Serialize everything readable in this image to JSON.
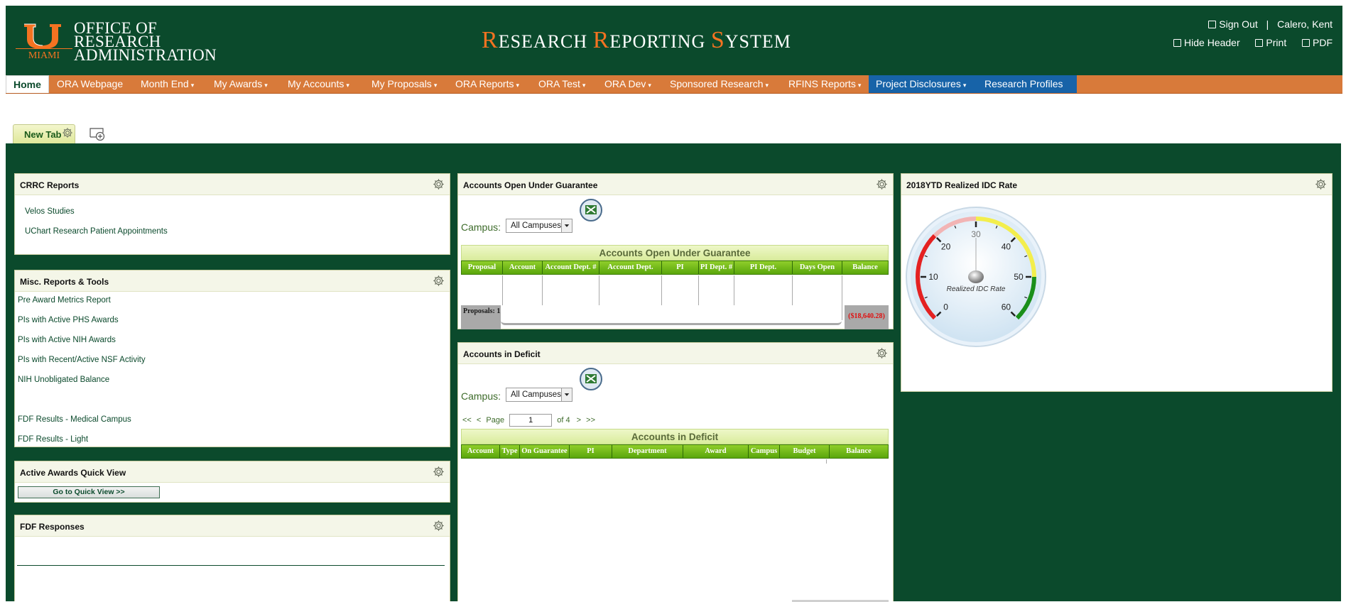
{
  "header": {
    "logo_text": "MIAMI",
    "office_title": [
      "OFFICE OF",
      "RESEARCH",
      "ADMINISTRATION"
    ],
    "system_title": [
      {
        "cap": "R",
        "rest": "ESEARCH "
      },
      {
        "cap": "R",
        "rest": "EPORTING "
      },
      {
        "cap": "S",
        "rest": "YSTEM"
      }
    ],
    "sign_out": "Sign Out",
    "separator": "|",
    "user_name": "Calero, Kent",
    "hide_header": "Hide Header",
    "print": "Print",
    "pdf": "PDF"
  },
  "nav": {
    "items": [
      {
        "label": "Home",
        "dropdown": false
      },
      {
        "label": "ORA Webpage",
        "dropdown": false
      },
      {
        "label": "Month End",
        "dropdown": true
      },
      {
        "label": "My Awards",
        "dropdown": true
      },
      {
        "label": "My Accounts",
        "dropdown": true
      },
      {
        "label": "My Proposals",
        "dropdown": true
      },
      {
        "label": "ORA Reports",
        "dropdown": true
      },
      {
        "label": "ORA Test",
        "dropdown": true
      },
      {
        "label": "ORA Dev",
        "dropdown": true
      },
      {
        "label": "Sponsored Research",
        "dropdown": true
      },
      {
        "label": "RFINS Reports",
        "dropdown": true
      },
      {
        "label": "Project Disclosures",
        "dropdown": true
      },
      {
        "label": "Research Profiles",
        "dropdown": false
      }
    ],
    "caret": "▾"
  },
  "tabs": {
    "new_tab": "New Tab"
  },
  "crrc": {
    "title": "CRRC Reports",
    "links": [
      "Velos Studies",
      "UChart Research Patient Appointments"
    ]
  },
  "misc": {
    "title": "Misc. Reports & Tools",
    "links": [
      "Pre Award Metrics Report",
      "PIs with Active PHS Awards",
      "PIs with Active NIH Awards",
      "PIs with Recent/Active NSF Activity",
      "NIH Unobligated Balance",
      "FDF Results - Medical Campus",
      "FDF Results - Light"
    ]
  },
  "quick": {
    "title": "Active Awards Quick View",
    "button": "Go to Quick View >>"
  },
  "fdf": {
    "title": "FDF Responses"
  },
  "guarantee": {
    "title": "Accounts Open Under Guarantee",
    "campus_label": "Campus:",
    "campus_value": "All Campuses",
    "table_caption": "Accounts Open Under Guarantee",
    "columns": [
      "Proposal",
      "Account",
      "Account Dept. #",
      "Account Dept.",
      "PI",
      "PI Dept. #",
      "PI Dept.",
      "Days Open",
      "Balance"
    ],
    "footer_label": "Proposals: 1",
    "footer_total": "($18,640.28)"
  },
  "deficit": {
    "title": "Accounts in Deficit",
    "campus_label": "Campus:",
    "campus_value": "All Campuses",
    "pager_first": "<<",
    "pager_prev": "<",
    "pager_page": "Page",
    "pager_value": "1",
    "pager_of": "of 4",
    "pager_next": ">",
    "pager_last": ">>",
    "table_caption": "Accounts in Deficit",
    "columns": [
      "Account",
      "Type",
      "On Guarantee",
      "PI",
      "Department",
      "Award",
      "Campus",
      "Budget",
      "Balance"
    ]
  },
  "idc": {
    "title": "2018YTD Realized IDC Rate",
    "gauge_label": "Realized IDC Rate",
    "ticks": [
      "0",
      "10",
      "20",
      "30",
      "40",
      "50",
      "60"
    ],
    "value": 30,
    "min": 0,
    "max": 60
  }
}
